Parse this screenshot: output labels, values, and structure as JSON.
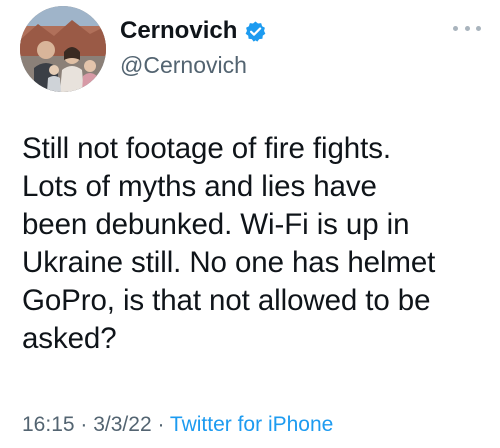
{
  "tweet": {
    "display_name": "Cernovich",
    "handle": "@Cernovich",
    "verified": true,
    "avatar": "family-photo-avatar",
    "more_icon": "more-dots-icon",
    "text": "Still not footage of fire fights.\nLots of myths and lies have\nbeen debunked. Wi-Fi is up in\nUkraine still. No one has helmet\nGoPro, is that not allowed to be\nasked?",
    "time": "16:15",
    "date": "3/3/22",
    "separator": "·",
    "source": "Twitter for iPhone"
  },
  "colors": {
    "text": "#0f1419",
    "secondary": "#536471",
    "link": "#1d9bf0",
    "verified_badge": "#1d9bf0"
  }
}
